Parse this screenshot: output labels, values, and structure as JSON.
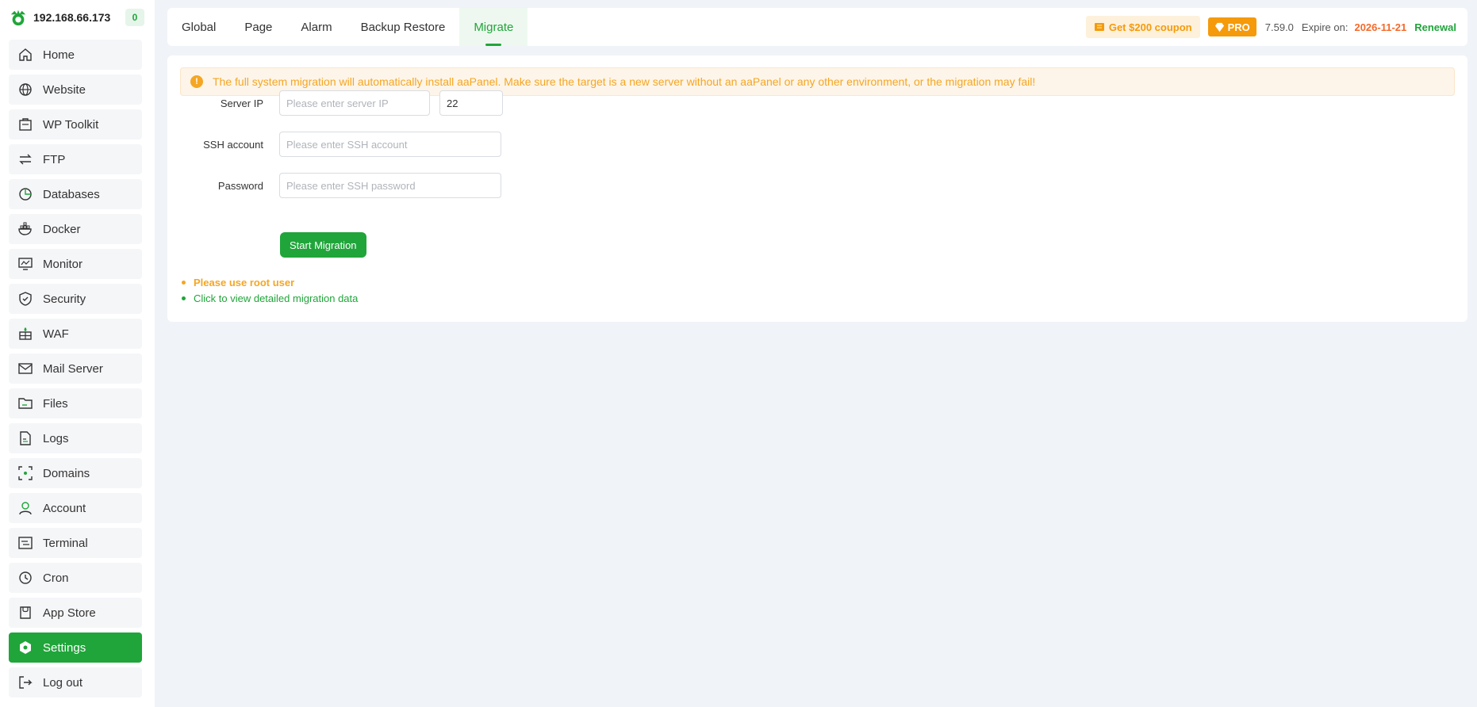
{
  "brand": {
    "ip": "192.168.66.173",
    "badge": "0"
  },
  "sidebar": {
    "items": [
      {
        "label": "Home",
        "icon": "home-icon"
      },
      {
        "label": "Website",
        "icon": "globe-icon"
      },
      {
        "label": "WP Toolkit",
        "icon": "toolkit-icon"
      },
      {
        "label": "FTP",
        "icon": "transfer-icon"
      },
      {
        "label": "Databases",
        "icon": "database-icon"
      },
      {
        "label": "Docker",
        "icon": "docker-icon"
      },
      {
        "label": "Monitor",
        "icon": "monitor-icon"
      },
      {
        "label": "Security",
        "icon": "shield-icon"
      },
      {
        "label": "WAF",
        "icon": "firewall-icon"
      },
      {
        "label": "Mail Server",
        "icon": "mail-icon"
      },
      {
        "label": "Files",
        "icon": "folder-icon"
      },
      {
        "label": "Logs",
        "icon": "log-icon"
      },
      {
        "label": "Domains",
        "icon": "domain-icon"
      },
      {
        "label": "Account",
        "icon": "user-icon"
      },
      {
        "label": "Terminal",
        "icon": "terminal-icon"
      },
      {
        "label": "Cron",
        "icon": "clock-icon"
      },
      {
        "label": "App Store",
        "icon": "store-icon"
      },
      {
        "label": "Settings",
        "icon": "settings-icon",
        "active": true
      },
      {
        "label": "Log out",
        "icon": "logout-icon"
      }
    ]
  },
  "tabs": [
    {
      "label": "Global"
    },
    {
      "label": "Page"
    },
    {
      "label": "Alarm"
    },
    {
      "label": "Backup Restore"
    },
    {
      "label": "Migrate",
      "active": true
    }
  ],
  "header": {
    "coupon": "Get $200 coupon",
    "pro": "PRO",
    "version": "7.59.0",
    "expire_label": "Expire on:",
    "expire_date": "2026-11-21",
    "renewal": "Renewal"
  },
  "alert": {
    "text": "The full system migration will automatically install aaPanel. Make sure the target is a new server without an aaPanel or any other environment, or the migration may fail!"
  },
  "form": {
    "server_ip_label": "Server IP",
    "server_ip_placeholder": "Please enter server IP",
    "port_value": "22",
    "ssh_account_label": "SSH account",
    "ssh_account_placeholder": "Please enter SSH account",
    "password_label": "Password",
    "password_placeholder": "Please enter SSH password",
    "start_button": "Start Migration"
  },
  "notes": {
    "warn": "Please use root user",
    "link": "Click to view detailed migration data"
  },
  "colors": {
    "accent": "#20a53a",
    "warning": "#f5a623",
    "pro": "#f59a0a",
    "expire": "#f5692a"
  }
}
